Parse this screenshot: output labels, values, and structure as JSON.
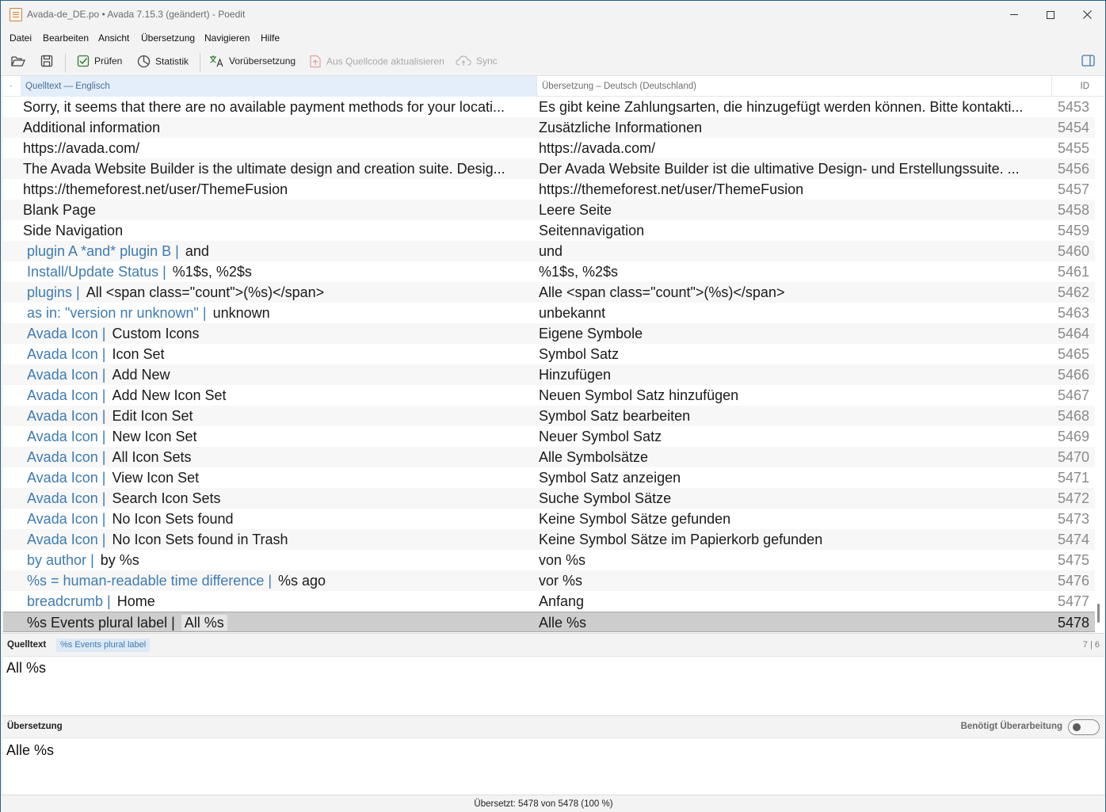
{
  "window": {
    "title": "Avada-de_DE.po • Avada 7.15.3 (geändert) - Poedit"
  },
  "menu": [
    "Datei",
    "Bearbeiten",
    "Ansicht",
    "Übersetzung",
    "Navigieren",
    "Hilfe"
  ],
  "toolbar": {
    "open_icon": "folder-open-icon",
    "save_icon": "save-icon",
    "check_label": "Prüfen",
    "stats_label": "Statistik",
    "pretranslate_label": "Vorübersetzung",
    "update_label": "Aus Quellcode aktualisieren",
    "sync_label": "Sync",
    "sidebar_icon": "sidebar-toggle-icon"
  },
  "list": {
    "headers": {
      "dot": "·",
      "source": "Quelltext — Englisch",
      "translation": "Übersetzung – Deutsch (Deutschland)",
      "id": "ID"
    },
    "rows": [
      {
        "context": "",
        "source": "Sorry, it seems that there are no available payment methods for your locati...",
        "translation": "Es gibt keine Zahlungsarten, die hinzugefügt werden können. Bitte kontakti...",
        "id": "5453"
      },
      {
        "context": "",
        "source": "Additional information",
        "translation": "Zusätzliche Informationen",
        "id": "5454"
      },
      {
        "context": "",
        "source": "https://avada.com/",
        "translation": "https://avada.com/",
        "id": "5455"
      },
      {
        "context": "",
        "source": "The Avada Website Builder is the ultimate design and creation suite. Desig...",
        "translation": "Der Avada Website Builder ist die ultimative Design- und Erstellungssuite. ...",
        "id": "5456"
      },
      {
        "context": "",
        "source": "https://themeforest.net/user/ThemeFusion",
        "translation": "https://themeforest.net/user/ThemeFusion",
        "id": "5457"
      },
      {
        "context": "",
        "source": "Blank Page",
        "translation": "Leere Seite",
        "id": "5458"
      },
      {
        "context": "",
        "source": "Side Navigation",
        "translation": "Seitennavigation",
        "id": "5459"
      },
      {
        "context": "plugin A *and* plugin B",
        "source": "and",
        "translation": "und",
        "id": "5460"
      },
      {
        "context": "Install/Update Status",
        "source": "%1$s, %2$s",
        "translation": "%1$s, %2$s",
        "id": "5461"
      },
      {
        "context": "plugins",
        "source": "All <span class=\"count\">(%s)</span>",
        "translation": "Alle <span class=\"count\">(%s)</span>",
        "id": "5462"
      },
      {
        "context": "as in: \"version nr unknown\"",
        "source": "unknown",
        "translation": "unbekannt",
        "id": "5463"
      },
      {
        "context": "Avada Icon",
        "source": "Custom Icons",
        "translation": "Eigene Symbole",
        "id": "5464"
      },
      {
        "context": "Avada Icon",
        "source": "Icon Set",
        "translation": "Symbol Satz",
        "id": "5465"
      },
      {
        "context": "Avada Icon",
        "source": "Add New",
        "translation": "Hinzufügen",
        "id": "5466"
      },
      {
        "context": "Avada Icon",
        "source": "Add New Icon Set",
        "translation": "Neuen Symbol Satz hinzufügen",
        "id": "5467"
      },
      {
        "context": "Avada Icon",
        "source": "Edit Icon Set",
        "translation": "Symbol Satz bearbeiten",
        "id": "5468"
      },
      {
        "context": "Avada Icon",
        "source": "New Icon Set",
        "translation": "Neuer Symbol Satz",
        "id": "5469"
      },
      {
        "context": "Avada Icon",
        "source": "All Icon Sets",
        "translation": "Alle Symbolsätze",
        "id": "5470"
      },
      {
        "context": "Avada Icon",
        "source": "View Icon Set",
        "translation": "Symbol Satz anzeigen",
        "id": "5471"
      },
      {
        "context": "Avada Icon",
        "source": "Search Icon Sets",
        "translation": "Suche Symbol Sätze",
        "id": "5472"
      },
      {
        "context": "Avada Icon",
        "source": "No Icon Sets found",
        "translation": "Keine Symbol Sätze gefunden",
        "id": "5473"
      },
      {
        "context": "Avada Icon",
        "source": "No Icon Sets found in Trash",
        "translation": "Keine Symbol Sätze im Papierkorb gefunden",
        "id": "5474"
      },
      {
        "context": "by author",
        "source": "by %s",
        "translation": "von %s",
        "id": "5475"
      },
      {
        "context": "%s = human-readable time difference",
        "source": "%s ago",
        "translation": "vor %s",
        "id": "5476"
      },
      {
        "context": "breadcrumb",
        "source": "Home",
        "translation": "Anfang",
        "id": "5477"
      },
      {
        "context": "%s Events plural label",
        "source": "All %s",
        "translation": "Alle %s",
        "id": "5478",
        "selected": true
      }
    ]
  },
  "source_panel": {
    "title": "Quelltext",
    "context_tag": "%s Events plural label",
    "count": "7 | 6",
    "text": "All %s"
  },
  "translation_panel": {
    "title": "Übersetzung",
    "fuzzy_label": "Benötigt Überarbeitung",
    "text": "Alle %s"
  },
  "status": {
    "text": "Übersetzt: 5478 von 5478 (100 %)"
  }
}
